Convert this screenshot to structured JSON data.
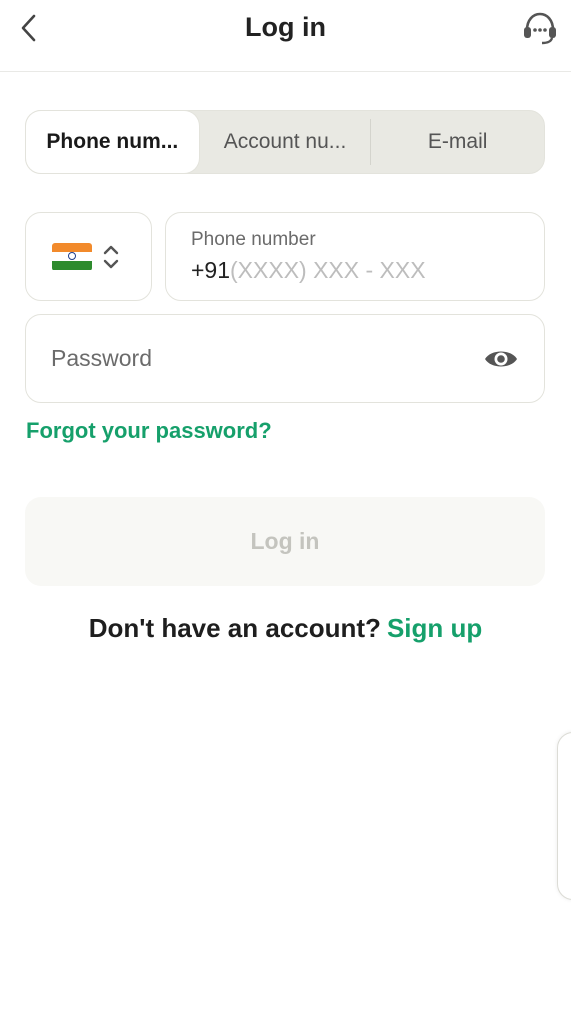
{
  "header": {
    "title": "Log in",
    "back_icon": "chevron-left-icon",
    "support_icon": "headset-support-icon"
  },
  "tabs": [
    {
      "label": "Phone num...",
      "active": true
    },
    {
      "label": "Account nu...",
      "active": false
    },
    {
      "label": "E-mail",
      "active": false
    }
  ],
  "phone": {
    "country_flag": "india-flag-icon",
    "label": "Phone number",
    "prefix": "+91",
    "placeholder": "(XXXX) XXX - XXX"
  },
  "password": {
    "placeholder": "Password",
    "toggle_icon": "eye-icon"
  },
  "forgot_password": "Forgot your password?",
  "login_button": "Log in",
  "signup": {
    "prompt": "Don't have an account?",
    "link": "Sign up"
  },
  "colors": {
    "accent": "#16a06b",
    "tab_bg": "#e9e9e3",
    "border": "#e3e3dc",
    "disabled_button_bg": "#f8f8f5",
    "disabled_button_text": "#c4c4be"
  }
}
